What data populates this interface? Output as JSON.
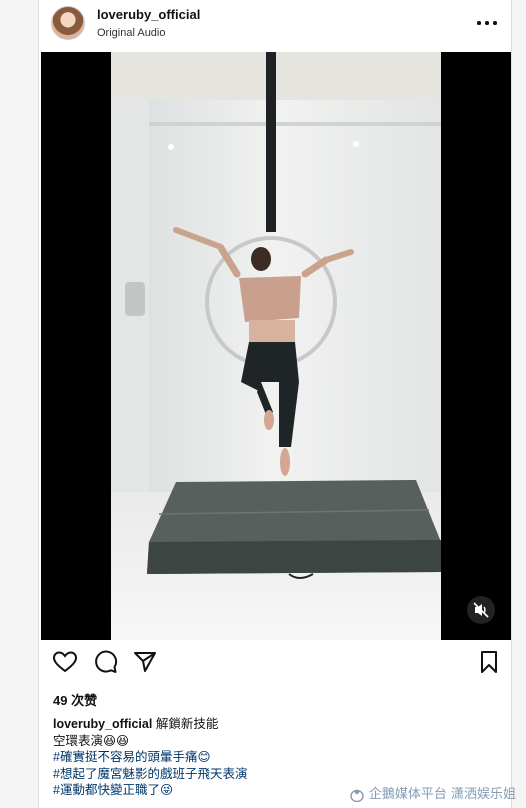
{
  "post": {
    "username": "loveruby_official",
    "audio_label": "Original Audio",
    "likes_text": "49 次赞"
  },
  "caption": {
    "username": "loveruby_official",
    "first_line": "解鎖新技能",
    "lines": [
      "空環表演😆😆",
      "#確實挺不容易的頭暈手痛😊",
      "#想起了魔宮魅影的戲班子飛天表演",
      "#運動都快變正職了😜"
    ]
  },
  "icons": {
    "more": "more-horizontal-icon",
    "mute": "muted-speaker-icon",
    "like": "heart-icon",
    "comment": "comment-bubble-icon",
    "share": "send-icon",
    "save": "bookmark-icon"
  },
  "watermark": {
    "text": "企鵝媒体平台 潇洒娱乐姐"
  },
  "colors": {
    "hashtag": "#00376b",
    "video_bg": "#000000",
    "mat": "#3c4542"
  }
}
